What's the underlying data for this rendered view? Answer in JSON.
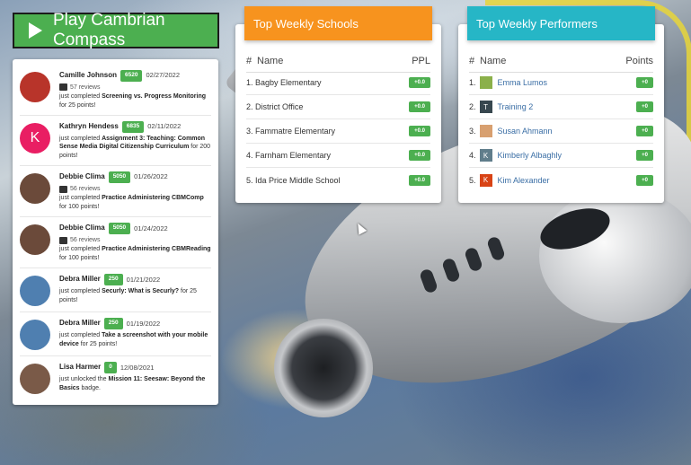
{
  "play_button": {
    "label": "Play Cambrian Compass"
  },
  "feed": [
    {
      "name": "Camille Johnson",
      "score": "6520",
      "date": "02/27/2022",
      "reviews": "57 reviews",
      "pre": "just completed ",
      "item": "Screening vs. Progress Monitoring",
      "mid": " for ",
      "points": "25 points!",
      "avatar_letter": "",
      "avatar_color": "#b8342a"
    },
    {
      "name": "Kathryn Hendess",
      "score": "6835",
      "date": "02/11/2022",
      "reviews": "",
      "pre": "just completed ",
      "item": "Assignment 3: Teaching: Common Sense Media Digital Citizenship Curriculum",
      "mid": " for ",
      "points": "200 points!",
      "avatar_letter": "K",
      "avatar_color": "#e91e63"
    },
    {
      "name": "Debbie Clima",
      "score": "5050",
      "date": "01/26/2022",
      "reviews": "56 reviews",
      "pre": "just completed ",
      "item": "Practice Administering CBMComp",
      "mid": " for ",
      "points": "100 points!",
      "avatar_letter": "",
      "avatar_color": "#6b4a3a"
    },
    {
      "name": "Debbie Clima",
      "score": "5050",
      "date": "01/24/2022",
      "reviews": "56 reviews",
      "pre": "just completed ",
      "item": "Practice Administering CBMReading",
      "mid": " for ",
      "points": "100 points!",
      "avatar_letter": "",
      "avatar_color": "#6b4a3a"
    },
    {
      "name": "Debra Miller",
      "score": "250",
      "date": "01/21/2022",
      "reviews": "",
      "pre": "just completed ",
      "item": "Securly: What is Securly?",
      "mid": " for ",
      "points": "25 points!",
      "avatar_letter": "",
      "avatar_color": "#4f7fb0"
    },
    {
      "name": "Debra Miller",
      "score": "250",
      "date": "01/19/2022",
      "reviews": "",
      "pre": "just completed ",
      "item": "Take a screenshot with your mobile device",
      "mid": " for ",
      "points": "25 points!",
      "avatar_letter": "",
      "avatar_color": "#4f7fb0"
    },
    {
      "name": "Lisa Harmer",
      "score": "0",
      "date": "12/08/2021",
      "reviews": "",
      "pre": "just unlocked the ",
      "item": "Mission 11: Seesaw: Beyond the Basics",
      "mid": " badge.",
      "points": "",
      "avatar_letter": "",
      "avatar_color": "#7a5a48"
    }
  ],
  "schools": {
    "title": "Top Weekly Schools",
    "header_color": "#f7931e",
    "col_hash": "#",
    "col_name": "Name",
    "col_score": "PPL",
    "rows": [
      {
        "name": "1. Bagby Elementary",
        "score": "+0.0"
      },
      {
        "name": "2. District Office",
        "score": "+0.0"
      },
      {
        "name": "3. Fammatre Elementary",
        "score": "+0.0"
      },
      {
        "name": "4. Farnham Elementary",
        "score": "+0.0"
      },
      {
        "name": "5. Ida Price Middle School",
        "score": "+0.0"
      }
    ]
  },
  "performers": {
    "title": "Top Weekly Performers",
    "header_color": "#26b6c6",
    "col_hash": "#",
    "col_name": "Name",
    "col_score": "Points",
    "rows": [
      {
        "rank": "1.",
        "name": "Emma Lumos",
        "score": "+0",
        "avatar_letter": "",
        "avatar_color": "#8bb04a"
      },
      {
        "rank": "2.",
        "name": "Training 2",
        "score": "+0",
        "avatar_letter": "T",
        "avatar_color": "#37474f"
      },
      {
        "rank": "3.",
        "name": "Susan Ahmann",
        "score": "+0",
        "avatar_letter": "",
        "avatar_color": "#d8a070"
      },
      {
        "rank": "4.",
        "name": "Kimberly Albaghly",
        "score": "+0",
        "avatar_letter": "K",
        "avatar_color": "#607d8b"
      },
      {
        "rank": "5.",
        "name": "Kim Alexander",
        "score": "+0",
        "avatar_letter": "K",
        "avatar_color": "#d84315"
      }
    ]
  }
}
